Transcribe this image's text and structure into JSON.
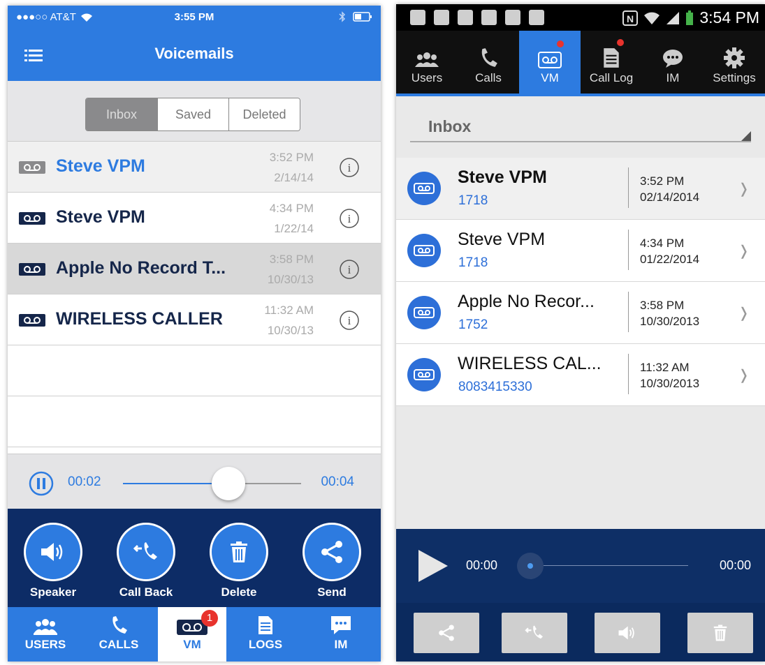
{
  "ios": {
    "status": {
      "carrier": "●●●○○ AT&T",
      "time": "3:55 PM"
    },
    "title": "Voicemails",
    "segments": [
      "Inbox",
      "Saved",
      "Deleted"
    ],
    "rows": [
      {
        "name": "Steve VPM",
        "time": "3:52 PM",
        "date": "2/14/14"
      },
      {
        "name": "Steve VPM",
        "time": "4:34 PM",
        "date": "1/22/14"
      },
      {
        "name": "Apple No Record T...",
        "time": "3:58 PM",
        "date": "10/30/13"
      },
      {
        "name": "WIRELESS CALLER",
        "time": "11:32 AM",
        "date": "10/30/13"
      }
    ],
    "player": {
      "elapsed": "00:02",
      "total": "00:04",
      "progress": 0.5
    },
    "actions": [
      "Speaker",
      "Call Back",
      "Delete",
      "Send"
    ],
    "tabs": [
      "USERS",
      "CALLS",
      "VM",
      "LOGS",
      "IM"
    ],
    "vm_badge": "1",
    "accent": "#2d7be0",
    "dark": "#0d2c66"
  },
  "android": {
    "status": {
      "time": "3:54 PM"
    },
    "tabs": [
      "Users",
      "Calls",
      "VM",
      "Call Log",
      "IM",
      "Settings"
    ],
    "folder": "Inbox",
    "rows": [
      {
        "name": "Steve VPM",
        "number": "1718",
        "time": "3:52 PM",
        "date": "02/14/2014"
      },
      {
        "name": "Steve VPM",
        "number": "1718",
        "time": "4:34 PM",
        "date": "01/22/2014"
      },
      {
        "name": "Apple No Recor...",
        "number": "1752",
        "time": "3:58 PM",
        "date": "10/30/2013"
      },
      {
        "name": "WIRELESS CAL...",
        "number": "8083415330",
        "time": "11:32 AM",
        "date": "10/30/2013"
      }
    ],
    "player": {
      "elapsed": "00:00",
      "total": "00:00",
      "progress": 0
    },
    "accent": "#2d7be0"
  }
}
